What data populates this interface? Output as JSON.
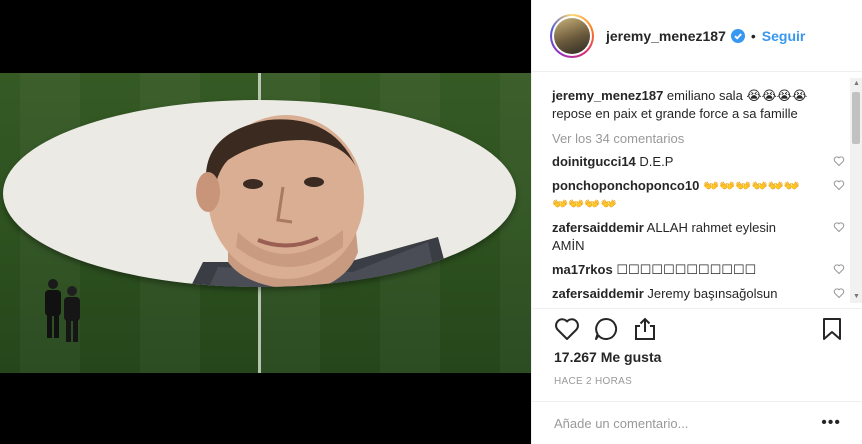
{
  "post": {
    "username": "jeremy_menez187",
    "follow_label": "Seguir",
    "separator": "•",
    "caption_user": "jeremy_menez187",
    "caption_text": " emiliano sala 😭😭😭😭 repose en paix et grande force a sa famille",
    "view_all_comments": "Ver los 34 comentarios",
    "likes": "17.267 Me gusta",
    "time_ago": "HACE 2 HORAS",
    "add_comment_placeholder": "Añade un comentario...",
    "more_label": "•••"
  },
  "comments": [
    {
      "user": "doinitgucci14",
      "text": " D.E.P"
    },
    {
      "user": "ponchoponchoponco10",
      "text": " 👐👐👐👐👐👐👐👐👐👐"
    },
    {
      "user": "zafersaiddemir",
      "text": " ALLAH rahmet eylesin AMİN"
    },
    {
      "user": "ma17rkos",
      "text": " ☐☐☐☐☐☐☐☐☐☐☐☐"
    },
    {
      "user": "zafersaiddemir",
      "text": " Jeremy başınsağolsun"
    }
  ],
  "icons": {
    "heart": "heart-icon",
    "comment": "comment-icon",
    "share": "share-icon",
    "bookmark": "bookmark-icon",
    "verified": "verified-badge-icon"
  },
  "colors": {
    "accent": "#3897f0",
    "text": "#262626",
    "muted": "#999999"
  }
}
